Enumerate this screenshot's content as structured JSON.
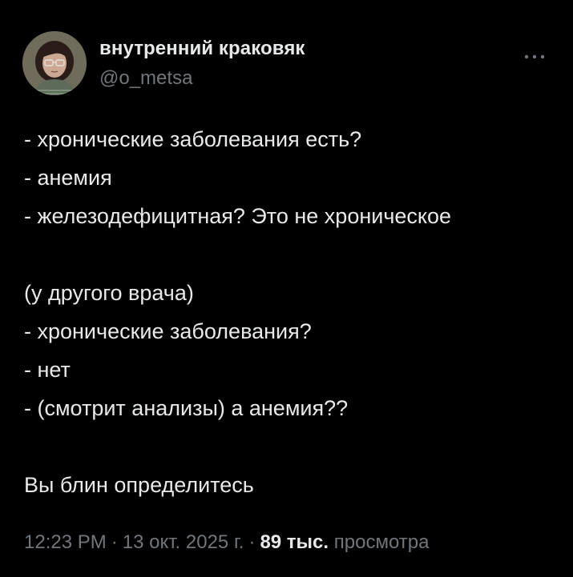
{
  "author": {
    "display_name": "внутренний краковяк",
    "handle": "@o_metsa"
  },
  "tweet": {
    "lines": [
      "- хронические заболевания есть?",
      "- анемия",
      "- железодефицитная? Это не хроническое",
      "",
      "(у другого врача)",
      "- хронические заболевания?",
      "- нет",
      "- (смотрит анализы) а анемия??",
      "",
      "Вы блин определитесь"
    ]
  },
  "meta": {
    "time": "12:23 PM",
    "date": "13 окт. 2025 г.",
    "separator": "·",
    "views_count": "89 тыс.",
    "views_label": "просмотра"
  },
  "icons": {
    "more": "more-horizontal-icon",
    "avatar": "avatar-image"
  },
  "colors": {
    "background": "#000000",
    "primary_text": "#e7e9ea",
    "secondary_text": "#71767b"
  }
}
